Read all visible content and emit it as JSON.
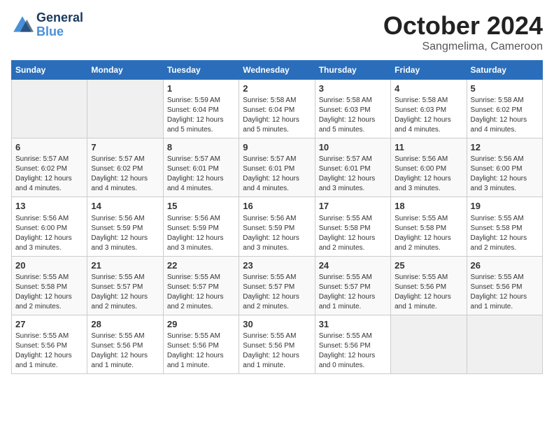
{
  "logo": {
    "line1": "General",
    "line2": "Blue"
  },
  "title": "October 2024",
  "subtitle": "Sangmelima, Cameroon",
  "days_of_week": [
    "Sunday",
    "Monday",
    "Tuesday",
    "Wednesday",
    "Thursday",
    "Friday",
    "Saturday"
  ],
  "weeks": [
    [
      {
        "day": "",
        "info": ""
      },
      {
        "day": "",
        "info": ""
      },
      {
        "day": "1",
        "info": "Sunrise: 5:59 AM\nSunset: 6:04 PM\nDaylight: 12 hours and 5 minutes."
      },
      {
        "day": "2",
        "info": "Sunrise: 5:58 AM\nSunset: 6:04 PM\nDaylight: 12 hours and 5 minutes."
      },
      {
        "day": "3",
        "info": "Sunrise: 5:58 AM\nSunset: 6:03 PM\nDaylight: 12 hours and 5 minutes."
      },
      {
        "day": "4",
        "info": "Sunrise: 5:58 AM\nSunset: 6:03 PM\nDaylight: 12 hours and 4 minutes."
      },
      {
        "day": "5",
        "info": "Sunrise: 5:58 AM\nSunset: 6:02 PM\nDaylight: 12 hours and 4 minutes."
      }
    ],
    [
      {
        "day": "6",
        "info": "Sunrise: 5:57 AM\nSunset: 6:02 PM\nDaylight: 12 hours and 4 minutes."
      },
      {
        "day": "7",
        "info": "Sunrise: 5:57 AM\nSunset: 6:02 PM\nDaylight: 12 hours and 4 minutes."
      },
      {
        "day": "8",
        "info": "Sunrise: 5:57 AM\nSunset: 6:01 PM\nDaylight: 12 hours and 4 minutes."
      },
      {
        "day": "9",
        "info": "Sunrise: 5:57 AM\nSunset: 6:01 PM\nDaylight: 12 hours and 4 minutes."
      },
      {
        "day": "10",
        "info": "Sunrise: 5:57 AM\nSunset: 6:01 PM\nDaylight: 12 hours and 3 minutes."
      },
      {
        "day": "11",
        "info": "Sunrise: 5:56 AM\nSunset: 6:00 PM\nDaylight: 12 hours and 3 minutes."
      },
      {
        "day": "12",
        "info": "Sunrise: 5:56 AM\nSunset: 6:00 PM\nDaylight: 12 hours and 3 minutes."
      }
    ],
    [
      {
        "day": "13",
        "info": "Sunrise: 5:56 AM\nSunset: 6:00 PM\nDaylight: 12 hours and 3 minutes."
      },
      {
        "day": "14",
        "info": "Sunrise: 5:56 AM\nSunset: 5:59 PM\nDaylight: 12 hours and 3 minutes."
      },
      {
        "day": "15",
        "info": "Sunrise: 5:56 AM\nSunset: 5:59 PM\nDaylight: 12 hours and 3 minutes."
      },
      {
        "day": "16",
        "info": "Sunrise: 5:56 AM\nSunset: 5:59 PM\nDaylight: 12 hours and 3 minutes."
      },
      {
        "day": "17",
        "info": "Sunrise: 5:55 AM\nSunset: 5:58 PM\nDaylight: 12 hours and 2 minutes."
      },
      {
        "day": "18",
        "info": "Sunrise: 5:55 AM\nSunset: 5:58 PM\nDaylight: 12 hours and 2 minutes."
      },
      {
        "day": "19",
        "info": "Sunrise: 5:55 AM\nSunset: 5:58 PM\nDaylight: 12 hours and 2 minutes."
      }
    ],
    [
      {
        "day": "20",
        "info": "Sunrise: 5:55 AM\nSunset: 5:58 PM\nDaylight: 12 hours and 2 minutes."
      },
      {
        "day": "21",
        "info": "Sunrise: 5:55 AM\nSunset: 5:57 PM\nDaylight: 12 hours and 2 minutes."
      },
      {
        "day": "22",
        "info": "Sunrise: 5:55 AM\nSunset: 5:57 PM\nDaylight: 12 hours and 2 minutes."
      },
      {
        "day": "23",
        "info": "Sunrise: 5:55 AM\nSunset: 5:57 PM\nDaylight: 12 hours and 2 minutes."
      },
      {
        "day": "24",
        "info": "Sunrise: 5:55 AM\nSunset: 5:57 PM\nDaylight: 12 hours and 1 minute."
      },
      {
        "day": "25",
        "info": "Sunrise: 5:55 AM\nSunset: 5:56 PM\nDaylight: 12 hours and 1 minute."
      },
      {
        "day": "26",
        "info": "Sunrise: 5:55 AM\nSunset: 5:56 PM\nDaylight: 12 hours and 1 minute."
      }
    ],
    [
      {
        "day": "27",
        "info": "Sunrise: 5:55 AM\nSunset: 5:56 PM\nDaylight: 12 hours and 1 minute."
      },
      {
        "day": "28",
        "info": "Sunrise: 5:55 AM\nSunset: 5:56 PM\nDaylight: 12 hours and 1 minute."
      },
      {
        "day": "29",
        "info": "Sunrise: 5:55 AM\nSunset: 5:56 PM\nDaylight: 12 hours and 1 minute."
      },
      {
        "day": "30",
        "info": "Sunrise: 5:55 AM\nSunset: 5:56 PM\nDaylight: 12 hours and 1 minute."
      },
      {
        "day": "31",
        "info": "Sunrise: 5:55 AM\nSunset: 5:56 PM\nDaylight: 12 hours and 0 minutes."
      },
      {
        "day": "",
        "info": ""
      },
      {
        "day": "",
        "info": ""
      }
    ]
  ]
}
